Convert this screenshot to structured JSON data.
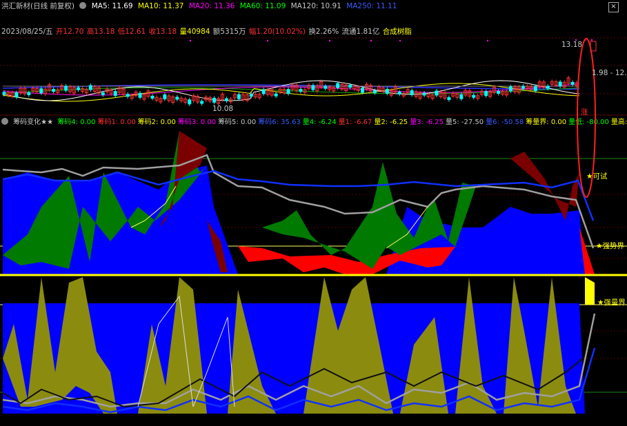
{
  "header": {
    "stock_title": "洪汇新材(日线 前复权)",
    "ma": [
      {
        "label": "MA5:",
        "value": "11.69",
        "color": "#ffffff"
      },
      {
        "label": "MA10:",
        "value": "11.37",
        "color": "#ffff00"
      },
      {
        "label": "MA20:",
        "value": "11.36",
        "color": "#ff00ff"
      },
      {
        "label": "MA60:",
        "value": "11.09",
        "color": "#00ff00"
      },
      {
        "label": "MA120:",
        "value": "10.91",
        "color": "#c8c8c8"
      },
      {
        "label": "MA250:",
        "value": "11.11",
        "color": "#3a5cff"
      }
    ],
    "close_icon": "×"
  },
  "quote": {
    "date": "2023/08/25/五",
    "items": [
      {
        "text": "开12.70",
        "color": "#ff3030"
      },
      {
        "text": "高13.18",
        "color": "#ff3030"
      },
      {
        "text": "低12.61",
        "color": "#ff3030"
      },
      {
        "text": "收13.18",
        "color": "#ff3030"
      },
      {
        "text": "量40984",
        "color": "#ffff00"
      },
      {
        "text": "额5315万",
        "color": "#c8c8c8"
      },
      {
        "text": "幅1.20(10.02%)",
        "color": "#ff3030"
      },
      {
        "text": "换2.26%",
        "color": "#c8c8c8"
      },
      {
        "text": "流通1.81亿",
        "color": "#c8c8c8"
      },
      {
        "text": "合成树脂",
        "color": "#ffff00"
      }
    ]
  },
  "price_labels": {
    "high": "13.18",
    "low": "10.08",
    "right": "1.98 - 12."
  },
  "indicator": {
    "title": "筹码变化★★",
    "items": [
      {
        "text": "筹码4: 0.00",
        "color": "#00ff00"
      },
      {
        "text": "筹码1: 0.00",
        "color": "#ff3030"
      },
      {
        "text": "筹码2: 0.00",
        "color": "#ffff00"
      },
      {
        "text": "筹码3: 0.00",
        "color": "#ff00ff"
      },
      {
        "text": "筹码5: 0.00",
        "color": "#c8c8c8"
      },
      {
        "text": "筹码6: 35.63",
        "color": "#3a5cff"
      },
      {
        "text": "量4: -6.24",
        "color": "#00ff00"
      },
      {
        "text": "量1: -6.67",
        "color": "#ff3030"
      },
      {
        "text": "量2: -6.25",
        "color": "#ffff00"
      },
      {
        "text": "量3: -6.25",
        "color": "#ff00ff"
      },
      {
        "text": "量5: -27.50",
        "color": "#c8c8c8"
      },
      {
        "text": "量6: -50.58",
        "color": "#3a5cff"
      },
      {
        "text": "筹量界: 0.00",
        "color": "#ffff00"
      },
      {
        "text": "量低: -80.00",
        "color": "#00ff00"
      },
      {
        "text": "量高:",
        "color": "#ffff00"
      }
    ]
  },
  "annotations": {
    "zhang": "涨",
    "ke_shi": "★可试",
    "qiang_shi": "★强势界",
    "qiang_liang": "★强量界"
  },
  "colors": {
    "background": "#000000",
    "up": "#ff3030",
    "down": "#00ffff",
    "blue": "#0000ff",
    "green": "#007a00",
    "red": "#ff0000",
    "olive": "#8b8b10",
    "highlight": "#ff2020"
  }
}
